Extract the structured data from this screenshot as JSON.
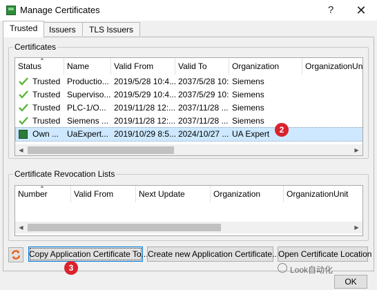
{
  "window": {
    "title": "Manage Certificates",
    "help": "?",
    "close": "✕"
  },
  "tabs": [
    {
      "label": "Trusted",
      "active": true
    },
    {
      "label": "Issuers",
      "active": false
    },
    {
      "label": "TLS Issuers",
      "active": false
    }
  ],
  "certificates": {
    "group_title": "Certificates",
    "columns": [
      "Status",
      "Name",
      "Valid From",
      "Valid To",
      "Organization",
      "OrganizationUnit"
    ],
    "rows": [
      {
        "status": "Trusted",
        "name": "Productio...",
        "valid_from": "2019/5/28 10:4...",
        "valid_to": "2037/5/28 10:...",
        "organization": "Siemens",
        "icon": "check-icon"
      },
      {
        "status": "Trusted",
        "name": "Superviso...",
        "valid_from": "2019/5/29 10:4...",
        "valid_to": "2037/5/29 10:...",
        "organization": "Siemens",
        "icon": "check-icon"
      },
      {
        "status": "Trusted",
        "name": "PLC-1/O...",
        "valid_from": "2019/11/28 12:...",
        "valid_to": "2037/11/28 ...",
        "organization": "Siemens",
        "icon": "check-icon"
      },
      {
        "status": "Trusted",
        "name": "Siemens ...",
        "valid_from": "2019/11/28 12:...",
        "valid_to": "2037/11/28 ...",
        "organization": "Siemens",
        "icon": "check-icon"
      },
      {
        "status": "Own ...",
        "name": "UaExpert...",
        "valid_from": "2019/10/29 8:5...",
        "valid_to": "2024/10/27 ...",
        "organization": "UA Expert",
        "icon": "own-certificate-icon",
        "selected": true
      }
    ]
  },
  "crl": {
    "group_title": "Certificate Revocation Lists",
    "columns": [
      "Number",
      "Valid From",
      "Next Update",
      "Organization",
      "OrganizationUnit"
    ]
  },
  "buttons": {
    "copy": "Copy Application Certificate To...",
    "create": "Create new Application Certificate...",
    "open": "Open Certificate Location",
    "ok": "OK"
  },
  "badges": [
    "2",
    "3"
  ],
  "watermark": "Look自动化",
  "colors": {
    "check": "#5bb53b",
    "selection": "#cde8ff",
    "badge": "#d9232d"
  }
}
